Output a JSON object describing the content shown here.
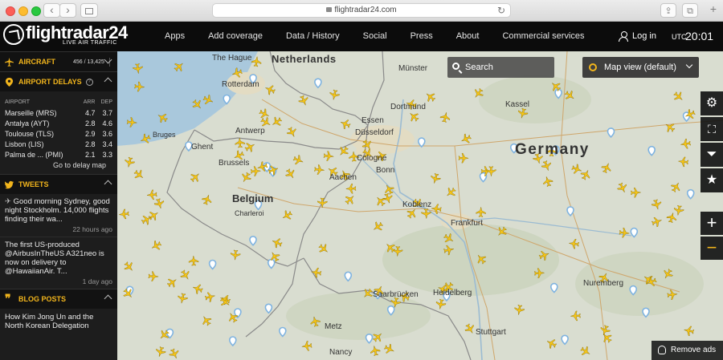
{
  "browser": {
    "url": "flightradar24.com",
    "back_glyph": "‹",
    "forward_glyph": "›",
    "reload_glyph": "↻",
    "share_glyph": "⇪",
    "tabs_glyph": "⧉",
    "newtab_glyph": "+"
  },
  "brand": {
    "name": "flightradar24",
    "tagline": "LIVE AIR TRAFFIC"
  },
  "nav": {
    "items": [
      "Apps",
      "Add coverage",
      "Data / History",
      "Social",
      "Press",
      "About",
      "Commercial services"
    ],
    "login": "Log in",
    "utc_label": "UTC",
    "time": "20:01"
  },
  "sidebar": {
    "aircraft": {
      "title": "AIRCRAFT",
      "count": "456 / 13,425"
    },
    "delays": {
      "title": "AIRPORT DELAYS",
      "columns": [
        "AIRPORT",
        "ARR",
        "DEP"
      ],
      "rows": [
        [
          "Marseille (MRS)",
          "4.7",
          "3.7"
        ],
        [
          "Antalya (AYT)",
          "2.8",
          "4.6"
        ],
        [
          "Toulouse (TLS)",
          "2.9",
          "3.6"
        ],
        [
          "Lisbon (LIS)",
          "2.8",
          "3.4"
        ],
        [
          "Palma de ... (PMI)",
          "2.1",
          "3.3"
        ]
      ],
      "link": "Go to delay map"
    },
    "tweets": {
      "title": "TWEETS",
      "items": [
        {
          "text": "Good morning Sydney, good night Stockholm. 14,000 flights finding their wa...",
          "time": "22 hours ago"
        },
        {
          "text": "The first US-produced @AirbusInTheUS A321neo is now on delivery to @HawaiianAir. T...",
          "time": "1 day ago"
        }
      ]
    },
    "blog": {
      "title": "BLOG POSTS",
      "items": [
        {
          "text": "How Kim Jong Un and the North Korean Delegation"
        }
      ]
    }
  },
  "map": {
    "search_placeholder": "Search",
    "view_label": "Map view (default)",
    "remove_ads": "Remove ads",
    "tool_glyphs": {
      "settings": "⚙",
      "fullscreen": "⛶",
      "filter": "⏷",
      "favorites": "★"
    },
    "zoom_in": "+",
    "zoom_out": "−",
    "labels": {
      "netherlands": "Netherlands",
      "germany": "Germany",
      "belgium": "Belgium",
      "rotterdam": "Rotterdam",
      "the_hague": "The Hague",
      "ghent": "Ghent",
      "bruges": "Bruges",
      "brussels": "Brussels",
      "antwerp": "Antwerp",
      "charleroi": "Charleroi",
      "essen": "Essen",
      "dortmund": "Dortmund",
      "dusseldorf": "Düsseldorf",
      "cologne": "Cologne",
      "bonn": "Bonn",
      "aachen": "Aachen",
      "koblenz": "Koblenz",
      "frankfurt": "Frankfurt",
      "munster": "Münster",
      "kassel": "Kassel",
      "nuremberg": "Nuremberg",
      "heidelberg": "Heidelberg",
      "stuttgart": "Stuttgart",
      "metz": "Metz",
      "nancy": "Nancy",
      "saarbrucken": "Saarbrücken"
    },
    "colors": {
      "plane": "#f5c518",
      "land": "#d9ddd0",
      "sea": "#a9c8dc",
      "marker": "#7fb3e0"
    }
  }
}
